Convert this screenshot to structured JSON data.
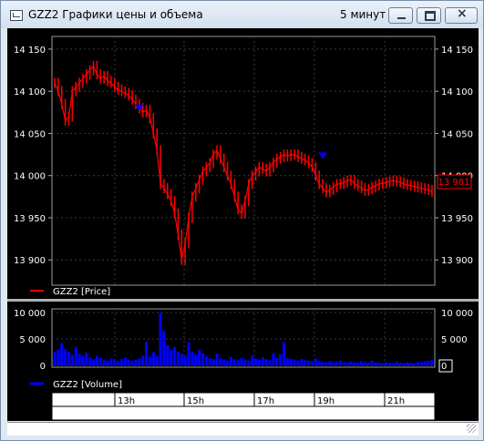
{
  "window": {
    "title": "GZZ2 Графики цены и объема",
    "interval": "5 минут"
  },
  "colors": {
    "background": "#000000",
    "price_line": "#ff0000",
    "volume_bars": "#0000ff",
    "markers": "#0000ff",
    "grid": "#444444",
    "axis_text": "#ffffff"
  },
  "price_panel": {
    "legend": "GZZ2 [Price]",
    "current_value_label": "13 981",
    "y_ticks": [
      "14 150",
      "14 100",
      "14 050",
      "14 000",
      "13 950",
      "13 900"
    ]
  },
  "volume_panel": {
    "legend": "GZZ2 [Volume]",
    "y_ticks": [
      "10 000",
      "5 000",
      "0"
    ]
  },
  "time_axis": {
    "ticks": [
      "13h",
      "15h",
      "17h",
      "19h",
      "21h"
    ]
  },
  "chart_data": [
    {
      "type": "line",
      "name": "GZZ2 [Price]",
      "ylim": [
        13870,
        14165
      ],
      "grid": true,
      "x": [
        0,
        2,
        4,
        6,
        8,
        10,
        12,
        14,
        16,
        18,
        20,
        22,
        24,
        26,
        28,
        30,
        32,
        34,
        36,
        38,
        40,
        42,
        44,
        46,
        48,
        50,
        52,
        54,
        56,
        58,
        60,
        62,
        64,
        66,
        68,
        70,
        72,
        74,
        76,
        78,
        80,
        82,
        84,
        86,
        88,
        90,
        92,
        94,
        96,
        98,
        100,
        102,
        104,
        106,
        108,
        110,
        112,
        114,
        116,
        118,
        120,
        122,
        124,
        126,
        128,
        130,
        132,
        134,
        136,
        138,
        140,
        142,
        144,
        146,
        148,
        150,
        152,
        154,
        156,
        158,
        160,
        162,
        164,
        166,
        168,
        170,
        172,
        174,
        176,
        178,
        180,
        182,
        184,
        186,
        188,
        190,
        192,
        194,
        196,
        198,
        200,
        202,
        204,
        206,
        208,
        210,
        212,
        214
      ],
      "values": [
        14110,
        14100,
        14085,
        14065,
        14070,
        14100,
        14105,
        14110,
        14115,
        14120,
        14125,
        14130,
        14120,
        14115,
        14118,
        14112,
        14110,
        14105,
        14102,
        14100,
        14098,
        14095,
        14090,
        14085,
        14080,
        14075,
        14078,
        14068,
        14050,
        14030,
        13990,
        13985,
        13978,
        13970,
        13955,
        13930,
        13900,
        13920,
        13950,
        13975,
        13985,
        13995,
        14005,
        14010,
        14015,
        14025,
        14030,
        14020,
        14010,
        14000,
        13990,
        13975,
        13960,
        13955,
        13970,
        13990,
        14000,
        14005,
        14010,
        14008,
        14005,
        14010,
        14015,
        14020,
        14022,
        14025,
        14023,
        14025,
        14025,
        14022,
        14020,
        14018,
        14015,
        14010,
        14000,
        13990,
        13985,
        13980,
        13983,
        13986,
        13990,
        13990,
        13992,
        13994,
        13995,
        13990,
        13988,
        13985,
        13982,
        13984,
        13986,
        13988,
        13990,
        13991,
        13992,
        13993,
        13994,
        13993,
        13992,
        13990,
        13989,
        13988,
        13987,
        13986,
        13985,
        13984,
        13983,
        13981
      ]
    },
    {
      "type": "bar",
      "name": "GZZ2 [Volume]",
      "ylim": [
        0,
        10000
      ],
      "x": [
        0,
        2,
        4,
        6,
        8,
        10,
        12,
        14,
        16,
        18,
        20,
        22,
        24,
        26,
        28,
        30,
        32,
        34,
        36,
        38,
        40,
        42,
        44,
        46,
        48,
        50,
        52,
        54,
        56,
        58,
        60,
        62,
        64,
        66,
        68,
        70,
        72,
        74,
        76,
        78,
        80,
        82,
        84,
        86,
        88,
        90,
        92,
        94,
        96,
        98,
        100,
        102,
        104,
        106,
        108,
        110,
        112,
        114,
        116,
        118,
        120,
        122,
        124,
        126,
        128,
        130,
        132,
        134,
        136,
        138,
        140,
        142,
        144,
        146,
        148,
        150,
        152,
        154,
        156,
        158,
        160,
        162,
        164,
        166,
        168,
        170,
        172,
        174,
        176,
        178,
        180,
        182,
        184,
        186,
        188,
        190,
        192,
        194,
        196,
        198,
        200,
        202,
        204,
        206,
        208,
        210,
        212,
        214
      ],
      "values": [
        2500,
        3000,
        4200,
        3100,
        2600,
        2000,
        3500,
        2200,
        1800,
        2400,
        1500,
        1200,
        1800,
        1400,
        1100,
        900,
        1300,
        1000,
        800,
        1200,
        1500,
        1000,
        900,
        1100,
        1300,
        1800,
        4500,
        1600,
        2500,
        1800,
        10000,
        6500,
        3800,
        2900,
        3500,
        2600,
        2200,
        1800,
        4400,
        2600,
        2100,
        2900,
        2300,
        1700,
        1400,
        1200,
        2200,
        1300,
        1100,
        900,
        1600,
        1200,
        1000,
        1400,
        1100,
        900,
        1800,
        1300,
        1100,
        1500,
        1200,
        1000,
        2300,
        1400,
        2100,
        4400,
        1400,
        1200,
        1100,
        900,
        1200,
        1000,
        900,
        800,
        1300,
        900,
        700,
        600,
        800,
        600,
        700,
        900,
        600,
        500,
        700,
        600,
        500,
        800,
        600,
        500,
        900,
        600,
        500,
        400,
        600,
        500,
        400,
        700,
        500,
        400,
        600,
        500,
        400,
        700,
        600,
        800,
        900,
        1100
      ]
    }
  ]
}
